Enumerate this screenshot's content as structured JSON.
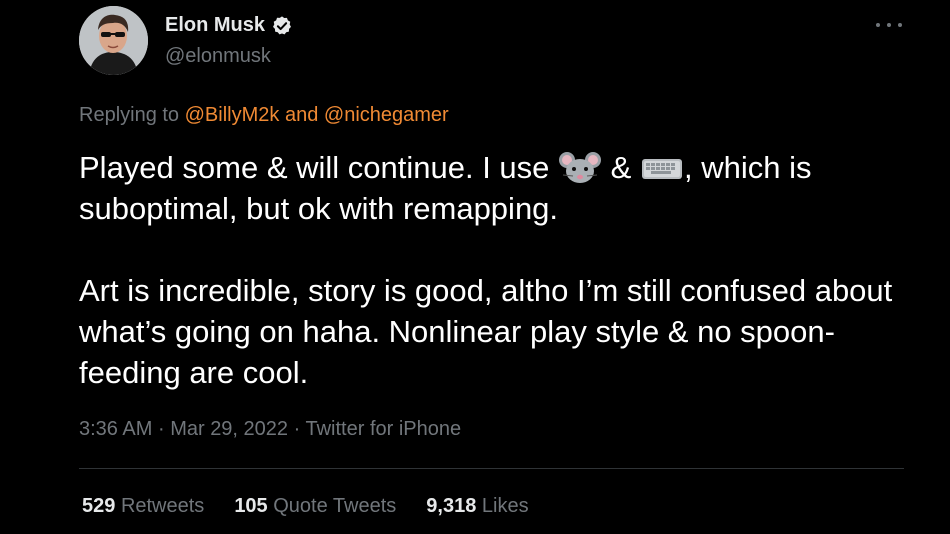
{
  "author": {
    "display_name": "Elon Musk",
    "handle": "@elonmusk",
    "verified": true,
    "avatar_icon": "profile-photo"
  },
  "reply": {
    "prefix": "Replying to",
    "user1": "@BillyM2k",
    "and": "and",
    "user2": "@nichegamer"
  },
  "body": {
    "p1_part1": "Played some & will continue. I use",
    "emoji1": "mouse-face-icon",
    "p1_part2": "&",
    "emoji2": "keyboard-icon",
    "p1_part3": ", which is suboptimal, but ok with remapping.",
    "p2": "Art is incredible, story is good, altho I’m still confused about what’s going on haha. Nonlinear play style & no spoon-feeding are cool."
  },
  "meta": {
    "time": "3:36 AM",
    "sep1": "·",
    "date": "Mar 29, 2022",
    "sep2": "·",
    "source": "Twitter for iPhone"
  },
  "stats": {
    "retweets_count": "529",
    "retweets_label": "Retweets",
    "quotes_count": "105",
    "quotes_label": "Quote Tweets",
    "likes_count": "9,318",
    "likes_label": "Likes"
  },
  "colors": {
    "background": "#000000",
    "text": "#e7e9ea",
    "muted": "#71767b",
    "mention": "#f08a34",
    "divider": "#2f3336"
  }
}
